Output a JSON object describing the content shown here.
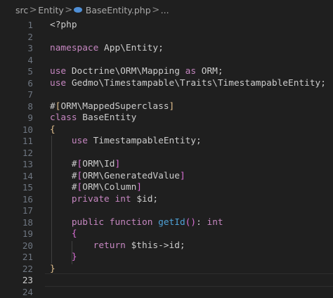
{
  "breadcrumb": {
    "items": [
      "src",
      "Entity",
      "BaseEntity.php",
      "..."
    ],
    "separator": ">",
    "file_icon": "php-icon"
  },
  "editor": {
    "active_line": 23,
    "lines": [
      {
        "n": "1",
        "tokens": [
          {
            "t": "<?php",
            "c": "plain"
          }
        ]
      },
      {
        "n": "2",
        "tokens": []
      },
      {
        "n": "3",
        "tokens": [
          {
            "t": "namespace",
            "c": "kw"
          },
          {
            "t": " App\\Entity;",
            "c": "plain"
          }
        ]
      },
      {
        "n": "4",
        "tokens": []
      },
      {
        "n": "5",
        "tokens": [
          {
            "t": "use",
            "c": "kw"
          },
          {
            "t": " Doctrine\\ORM\\Mapping ",
            "c": "plain"
          },
          {
            "t": "as",
            "c": "kw"
          },
          {
            "t": " ORM;",
            "c": "plain"
          }
        ]
      },
      {
        "n": "6",
        "tokens": [
          {
            "t": "use",
            "c": "kw"
          },
          {
            "t": " Gedmo\\Timestampable\\Traits\\TimestampableEntity;",
            "c": "plain"
          }
        ]
      },
      {
        "n": "7",
        "tokens": []
      },
      {
        "n": "8",
        "tokens": [
          {
            "t": "#",
            "c": "plain"
          },
          {
            "t": "[",
            "c": "brace"
          },
          {
            "t": "ORM\\MappedSuperclass",
            "c": "plain"
          },
          {
            "t": "]",
            "c": "brace"
          }
        ]
      },
      {
        "n": "9",
        "tokens": [
          {
            "t": "class",
            "c": "kw"
          },
          {
            "t": " BaseEntity",
            "c": "plain"
          }
        ]
      },
      {
        "n": "10",
        "tokens": [
          {
            "t": "{",
            "c": "brace"
          }
        ]
      },
      {
        "n": "11",
        "tokens": [
          {
            "t": "    ",
            "c": "plain"
          },
          {
            "t": "use",
            "c": "kw"
          },
          {
            "t": " TimestampableEntity;",
            "c": "plain"
          }
        ]
      },
      {
        "n": "12",
        "tokens": []
      },
      {
        "n": "13",
        "tokens": [
          {
            "t": "    #",
            "c": "plain"
          },
          {
            "t": "[",
            "c": "paren"
          },
          {
            "t": "ORM\\Id",
            "c": "plain"
          },
          {
            "t": "]",
            "c": "paren"
          }
        ]
      },
      {
        "n": "14",
        "tokens": [
          {
            "t": "    #",
            "c": "plain"
          },
          {
            "t": "[",
            "c": "paren"
          },
          {
            "t": "ORM\\GeneratedValue",
            "c": "plain"
          },
          {
            "t": "]",
            "c": "paren"
          }
        ]
      },
      {
        "n": "15",
        "tokens": [
          {
            "t": "    #",
            "c": "plain"
          },
          {
            "t": "[",
            "c": "paren"
          },
          {
            "t": "ORM\\Column",
            "c": "plain"
          },
          {
            "t": "]",
            "c": "paren"
          }
        ]
      },
      {
        "n": "16",
        "tokens": [
          {
            "t": "    ",
            "c": "plain"
          },
          {
            "t": "private",
            "c": "kw"
          },
          {
            "t": " ",
            "c": "plain"
          },
          {
            "t": "int",
            "c": "kw"
          },
          {
            "t": " $id;",
            "c": "plain"
          }
        ]
      },
      {
        "n": "17",
        "tokens": []
      },
      {
        "n": "18",
        "tokens": [
          {
            "t": "    ",
            "c": "plain"
          },
          {
            "t": "public",
            "c": "kw"
          },
          {
            "t": " ",
            "c": "plain"
          },
          {
            "t": "function",
            "c": "kw"
          },
          {
            "t": " ",
            "c": "plain"
          },
          {
            "t": "getId",
            "c": "fn"
          },
          {
            "t": "()",
            "c": "paren"
          },
          {
            "t": ": ",
            "c": "plain"
          },
          {
            "t": "int",
            "c": "kw"
          }
        ]
      },
      {
        "n": "19",
        "tokens": [
          {
            "t": "    ",
            "c": "plain"
          },
          {
            "t": "{",
            "c": "paren"
          }
        ]
      },
      {
        "n": "20",
        "tokens": [
          {
            "t": "        ",
            "c": "plain"
          },
          {
            "t": "return",
            "c": "kw"
          },
          {
            "t": " $this->id;",
            "c": "plain"
          }
        ]
      },
      {
        "n": "21",
        "tokens": [
          {
            "t": "    ",
            "c": "plain"
          },
          {
            "t": "}",
            "c": "paren"
          }
        ]
      },
      {
        "n": "22",
        "tokens": [
          {
            "t": "}",
            "c": "brace"
          }
        ]
      },
      {
        "n": "23",
        "tokens": []
      },
      {
        "n": "24",
        "tokens": []
      }
    ]
  },
  "colors": {
    "background": "#1f1f1f",
    "keyword": "#c586c0",
    "function": "#4ea1d6",
    "brace": "#e2c08d",
    "paren": "#da70d6",
    "text": "#cccccc",
    "line_number": "#6e7681"
  }
}
